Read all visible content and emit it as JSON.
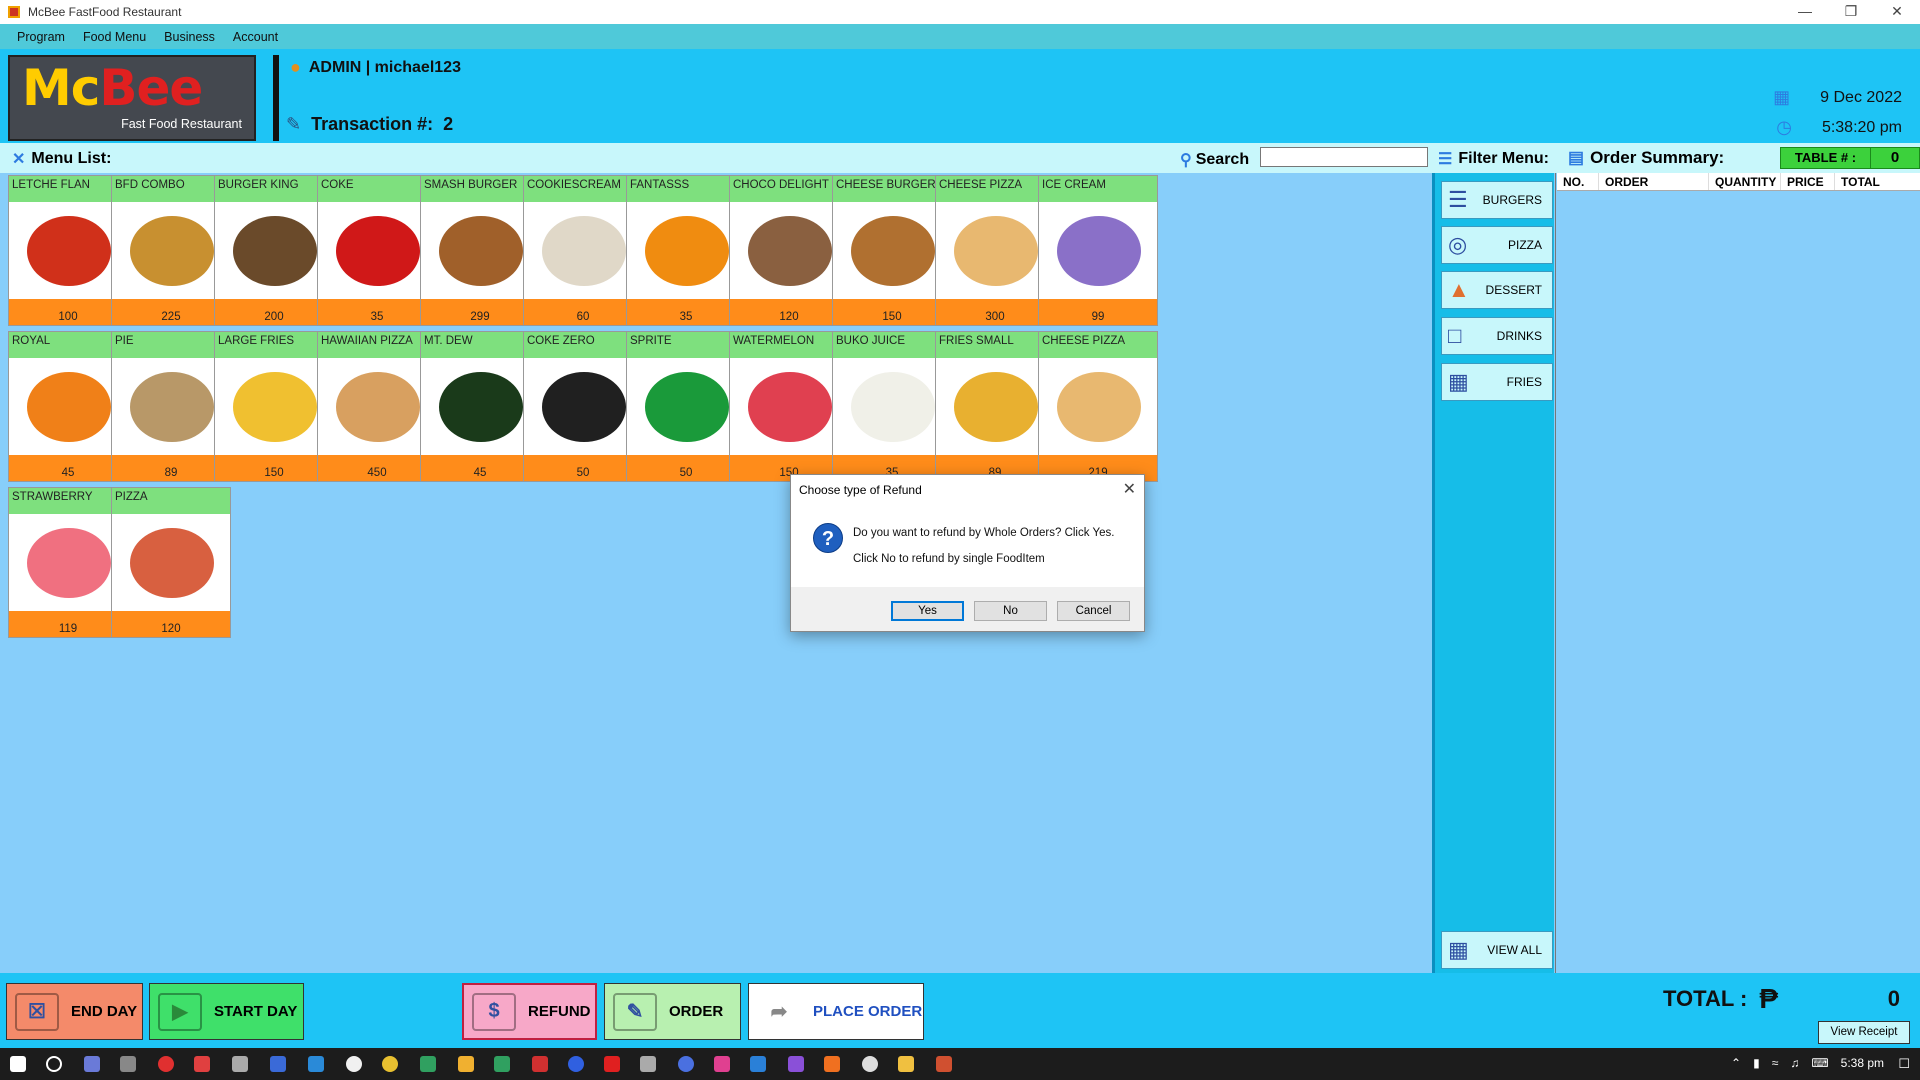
{
  "window": {
    "title": "McBee FastFood Restaurant",
    "controls": [
      "—",
      "❐",
      "✕"
    ]
  },
  "menubar": [
    "Program",
    "Food Menu",
    "Business",
    "Account"
  ],
  "header": {
    "logo_mc": "Mc",
    "logo_bee": "Bee",
    "logo_sub": "Fast Food Restaurant",
    "user": "ADMIN | michael123",
    "transaction_label": "Transaction #:",
    "transaction_value": "2",
    "date": "9 Dec 2022",
    "time": "5:38:20 pm"
  },
  "menu_list": {
    "label": "Menu List:",
    "search_label": "Search",
    "search_value": "",
    "items": [
      {
        "name": "LETCHE FLAN",
        "price": "100",
        "color": "#d0301a"
      },
      {
        "name": "BFD COMBO",
        "price": "225",
        "color": "#c89030"
      },
      {
        "name": "BURGER KING",
        "price": "200",
        "color": "#6a4a2a"
      },
      {
        "name": "COKE",
        "price": "35",
        "color": "#d01818"
      },
      {
        "name": "SMASH BURGER",
        "price": "299",
        "color": "#a0602a"
      },
      {
        "name": "COOKIESCREAM",
        "price": "60",
        "color": "#e0d8c8"
      },
      {
        "name": "FANTASSS",
        "price": "35",
        "color": "#f08c10"
      },
      {
        "name": "CHOCO DELIGHT",
        "price": "120",
        "color": "#8a6040"
      },
      {
        "name": "CHEESE BURGER",
        "price": "150",
        "color": "#b07030"
      },
      {
        "name": "CHEESE PIZZA",
        "price": "300",
        "color": "#e8b870"
      },
      {
        "name": "ICE CREAM",
        "price": "99",
        "color": "#8a70c8"
      },
      {
        "name": "ROYAL",
        "price": "45",
        "color": "#f08018"
      },
      {
        "name": "PIE",
        "price": "89",
        "color": "#b89868"
      },
      {
        "name": "LARGE FRIES",
        "price": "150",
        "color": "#f0c030"
      },
      {
        "name": "HAWAIIAN PIZZA",
        "price": "450",
        "color": "#d8a060"
      },
      {
        "name": "MT. DEW",
        "price": "45",
        "color": "#1a3a1a"
      },
      {
        "name": "COKE ZERO",
        "price": "50",
        "color": "#202020"
      },
      {
        "name": "SPRITE",
        "price": "50",
        "color": "#1a9a3a"
      },
      {
        "name": "WATERMELON",
        "price": "150",
        "color": "#e04050"
      },
      {
        "name": "BUKO JUICE",
        "price": "35",
        "color": "#f0f0e8"
      },
      {
        "name": "FRIES SMALL",
        "price": "89",
        "color": "#e8b030"
      },
      {
        "name": "CHEESE PIZZA",
        "price": "219",
        "color": "#e8b870"
      },
      {
        "name": "STRAWBERRY",
        "price": "119",
        "color": "#f07080"
      },
      {
        "name": "PIZZA",
        "price": "120",
        "color": "#d86040"
      }
    ]
  },
  "filter": {
    "label": "Filter Menu:",
    "buttons": [
      "BURGERS",
      "PIZZA",
      "DESSERT",
      "DRINKS",
      "FRIES"
    ],
    "view_all": "VIEW ALL"
  },
  "order": {
    "label": "Order Summary:",
    "table_label": "TABLE # :",
    "table_value": "0",
    "columns": [
      "NO.",
      "ORDER",
      "QUANTITY",
      "PRICE",
      "TOTAL"
    ]
  },
  "bottom": {
    "end_day": "END DAY",
    "start_day": "START DAY",
    "refund": "REFUND",
    "order": "ORDER",
    "place_order": "PLACE ORDER",
    "total_label": "TOTAL :",
    "currency": "₱",
    "total_value": "0",
    "view_receipt": "View Receipt"
  },
  "dialog": {
    "title": "Choose type of Refund",
    "line1": "Do you want to refund by Whole Orders? Click Yes.",
    "line2": "Click No to refund by single FoodItem",
    "yes": "Yes",
    "no": "No",
    "cancel": "Cancel"
  },
  "taskbar": {
    "time": "5:38 pm"
  }
}
